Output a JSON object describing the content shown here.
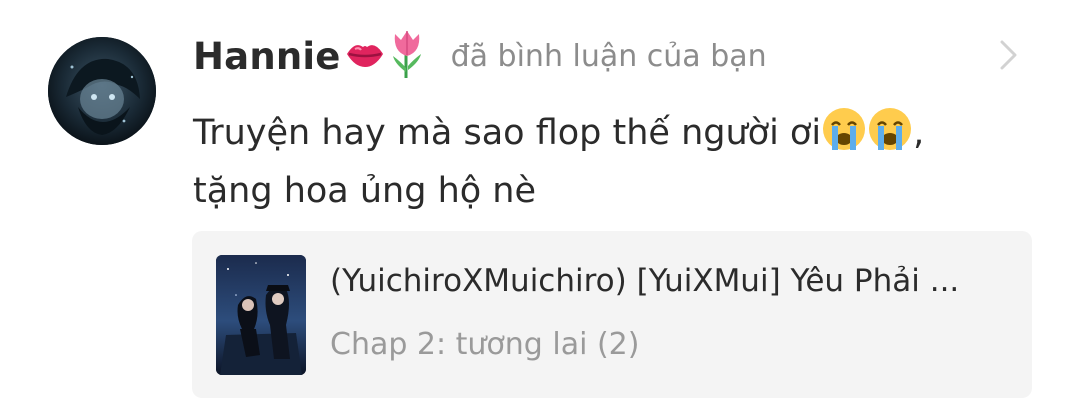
{
  "notification": {
    "username": "Hannie",
    "username_emojis": [
      "lips-icon",
      "tulip-icon"
    ],
    "action_text": "đã bình luận của bạn",
    "comment_line1": "Truyện hay mà sao flop thế người ơi",
    "comment_suffix": ",",
    "comment_line2": "tặng hoa ủng hộ nè",
    "comment_emojis": [
      "crying-face-icon",
      "crying-face-icon"
    ]
  },
  "story": {
    "title": "(YuichiroXMuichiro) [YuiXMui] Yêu Phải ...",
    "chapter": "Chap 2: tương lai (2)"
  },
  "colors": {
    "name": "#2b2b2b",
    "muted": "#8c8c8c",
    "card_bg": "#f4f4f4"
  }
}
